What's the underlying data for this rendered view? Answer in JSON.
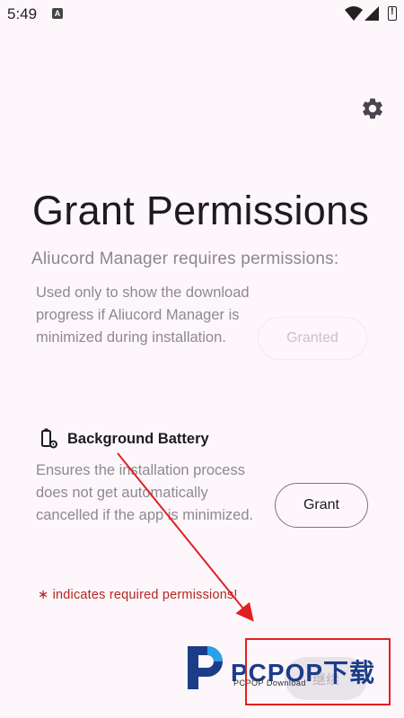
{
  "status_bar": {
    "time": "5:49",
    "notification_icon": "A"
  },
  "header": {
    "settings_icon": "gear-icon"
  },
  "title": "Grant Permissions",
  "subtitle": "Aliucord Manager requires permissions:",
  "permissions": [
    {
      "description": "Used only to show the download progress if Aliucord Manager is minimized during installation.",
      "button_label": "Granted",
      "granted": true
    },
    {
      "title": "Background Battery",
      "icon": "battery-gear-icon",
      "description": "Ensures the installation process does not get automatically cancelled if the app is minimized.",
      "button_label": "Grant",
      "granted": false
    }
  ],
  "required_note": "∗ indicates required permissions!",
  "continue_label": "继续",
  "watermark": {
    "brand": "PCPOP",
    "brand_cn": "下载",
    "sub": "PCPOP Download"
  },
  "colors": {
    "accent_error": "#b3261e",
    "annotation": "#e02020",
    "background": "#fdf7fc"
  }
}
